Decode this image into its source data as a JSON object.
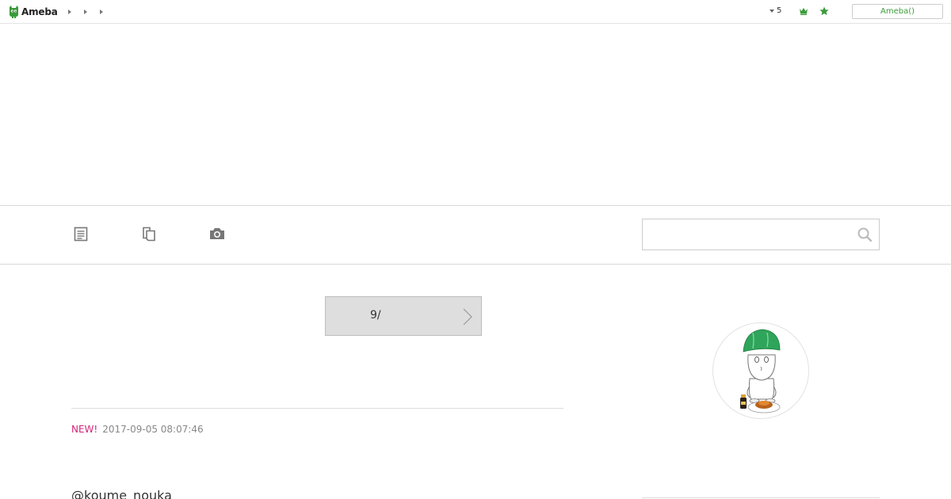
{
  "header": {
    "logo_text": "Ameba",
    "notification_count": "5",
    "ameba_button_label": "Ameba()"
  },
  "nav": {
    "items": [
      {
        "icon": "article-list-icon"
      },
      {
        "icon": "theme-list-icon"
      },
      {
        "icon": "camera-icon"
      }
    ],
    "search_placeholder": "",
    "search_value": ""
  },
  "main": {
    "pager_label": "9/",
    "post": {
      "new_badge": "NEW!",
      "date": "2017-09-05 08:07:46",
      "title": "@koume_nouka"
    }
  },
  "colors": {
    "accent_green": "#3a9b3a",
    "new_badge": "#d4247a"
  }
}
